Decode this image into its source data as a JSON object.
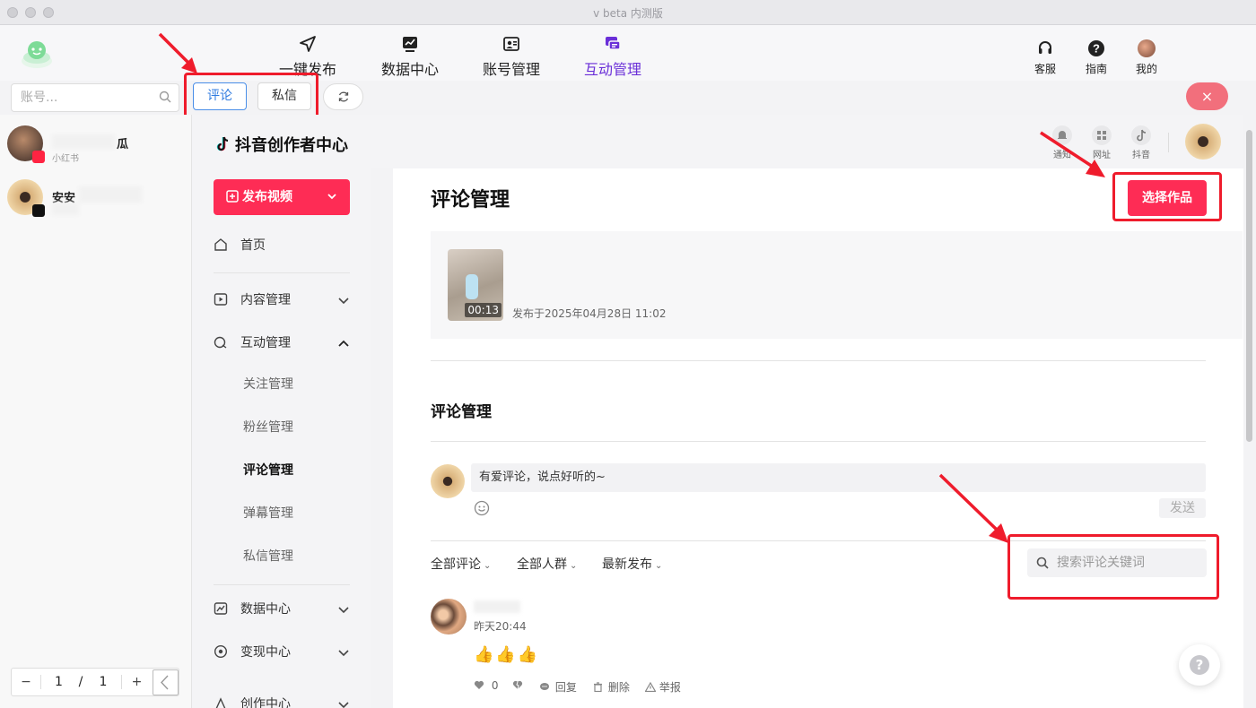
{
  "window": {
    "title": "v beta 内测版"
  },
  "topnav": {
    "items": [
      {
        "label": "一键发布"
      },
      {
        "label": "数据中心"
      },
      {
        "label": "账号管理"
      },
      {
        "label": "互动管理"
      }
    ],
    "right": [
      {
        "label": "客服"
      },
      {
        "label": "指南"
      },
      {
        "label": "我的"
      }
    ]
  },
  "toolbar": {
    "account_search_placeholder": "账号...",
    "tab_comment": "评论",
    "tab_dm": "私信",
    "close_label": "×"
  },
  "accounts": [
    {
      "name": "瓜",
      "sub": "小红书"
    },
    {
      "name": "安安",
      "sub": ""
    }
  ],
  "pager": {
    "minus": "−",
    "current": "1",
    "sep": "/",
    "total": "1",
    "plus": "+"
  },
  "douyin": {
    "brand": "抖音创作者中心",
    "publish_label": "发布视频",
    "sidebar": {
      "home": "首页",
      "content": "内容管理",
      "interaction": "互动管理",
      "sub_follow": "关注管理",
      "sub_fans": "粉丝管理",
      "sub_comment": "评论管理",
      "sub_danmaku": "弹幕管理",
      "sub_dm": "私信管理",
      "data": "数据中心",
      "monetize": "变现中心",
      "creation": "创作中心"
    },
    "header_icons": [
      {
        "label": "通知"
      },
      {
        "label": "网址"
      },
      {
        "label": "抖音"
      }
    ]
  },
  "main": {
    "page_title": "评论管理",
    "select_work_label": "选择作品",
    "video": {
      "duration": "00:13",
      "published": "发布于2025年04月28日 11:02"
    },
    "section_title": "评论管理",
    "comment_placeholder": "有爱评论，说点好听的~",
    "send_label": "发送",
    "filters": [
      "全部评论",
      "全部人群",
      "最新发布"
    ],
    "search_placeholder": "搜索评论关键词",
    "comment": {
      "time": "昨天20:44",
      "content": "👍👍👍",
      "likes": "0",
      "reply_label": "回复",
      "delete_label": "删除",
      "report_label": "举报"
    }
  },
  "colors": {
    "accent_douyin": "#fe2c55",
    "nav_active": "#6a2fd8",
    "annotation_red": "#ef1c2c"
  }
}
